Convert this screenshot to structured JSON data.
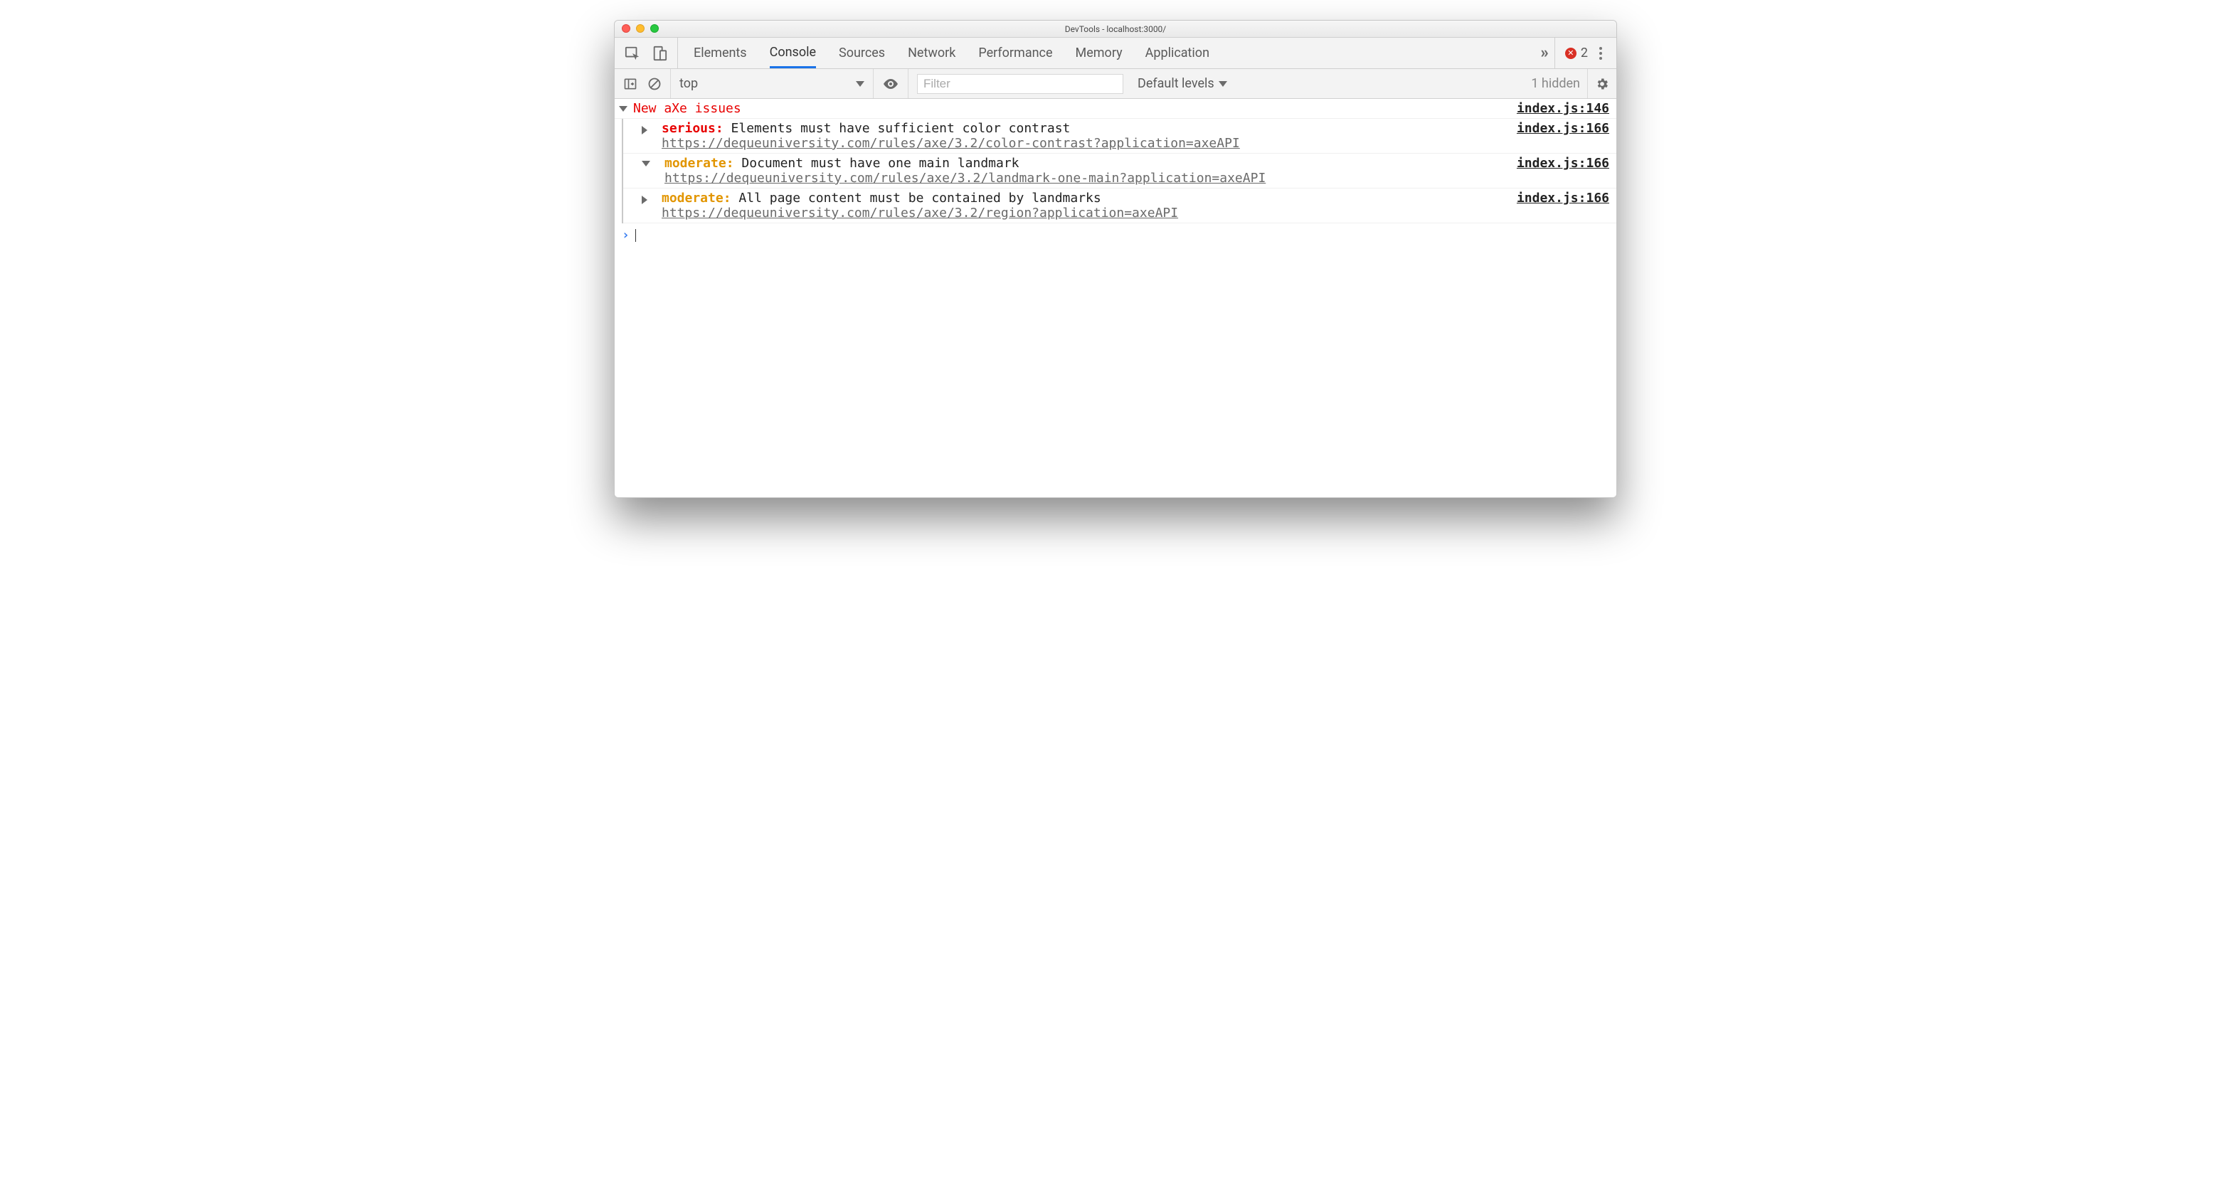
{
  "window": {
    "title": "DevTools - localhost:3000/"
  },
  "tabs": {
    "items": [
      "Elements",
      "Console",
      "Sources",
      "Network",
      "Performance",
      "Memory",
      "Application"
    ],
    "active_index": 1,
    "error_count": "2"
  },
  "toolbar": {
    "context": "top",
    "filter_placeholder": "Filter",
    "levels_label": "Default levels",
    "hidden_label": "1 hidden"
  },
  "console": {
    "group_title": "New aXe issues",
    "group_src": "index.js:146",
    "items": [
      {
        "expanded": false,
        "severity": "serious",
        "severity_label": "serious:",
        "message": "Elements must have sufficient color contrast",
        "link": "https://dequeuniversity.com/rules/axe/3.2/color-contrast?application=axeAPI",
        "src": "index.js:166"
      },
      {
        "expanded": true,
        "severity": "moderate",
        "severity_label": "moderate:",
        "message": "Document must have one main landmark",
        "link": "https://dequeuniversity.com/rules/axe/3.2/landmark-one-main?application=axeAPI",
        "src": "index.js:166"
      },
      {
        "expanded": false,
        "severity": "moderate",
        "severity_label": "moderate:",
        "message": "All page content must be contained by landmarks",
        "link": "https://dequeuniversity.com/rules/axe/3.2/region?application=axeAPI",
        "src": "index.js:166"
      }
    ],
    "prompt": "›"
  }
}
